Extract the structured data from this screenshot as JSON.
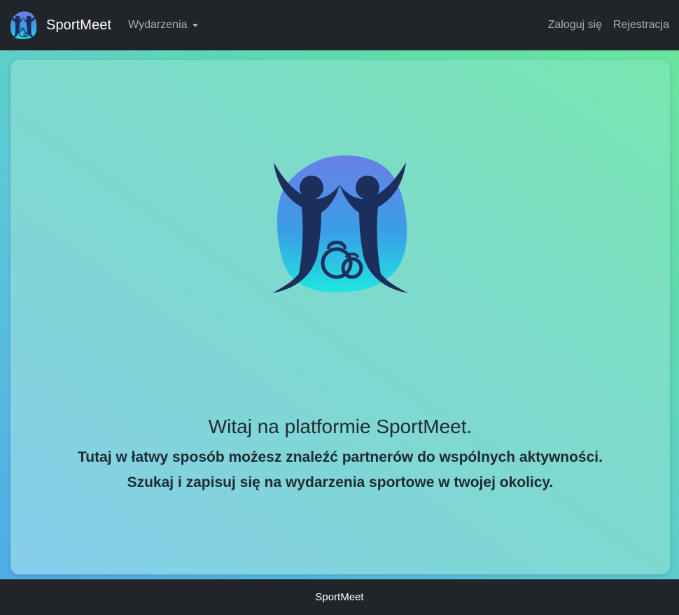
{
  "navbar": {
    "brand": "SportMeet",
    "brand_logo_icon": "sportmeet-logo-icon",
    "events_dropdown": "Wydarzenia",
    "login": "Zaloguj się",
    "register": "Rejestracja"
  },
  "hero": {
    "logo_icon": "sportmeet-logo-icon",
    "title": "Witaj na platformie SportMeet.",
    "line1": "Tutaj w łatwy sposób możesz znaleźć partnerów do wspólnych aktywności.",
    "line2": "Szukaj i zapisuj się na wydarzenia sportowe w twojej okolicy."
  },
  "footer": {
    "text": "SportMeet"
  },
  "colors": {
    "navbar_bg": "#212529",
    "figure_dark": "#1c2e5c",
    "blob_top": "#6a7fe6",
    "blob_bottom": "#1ee0e0"
  }
}
